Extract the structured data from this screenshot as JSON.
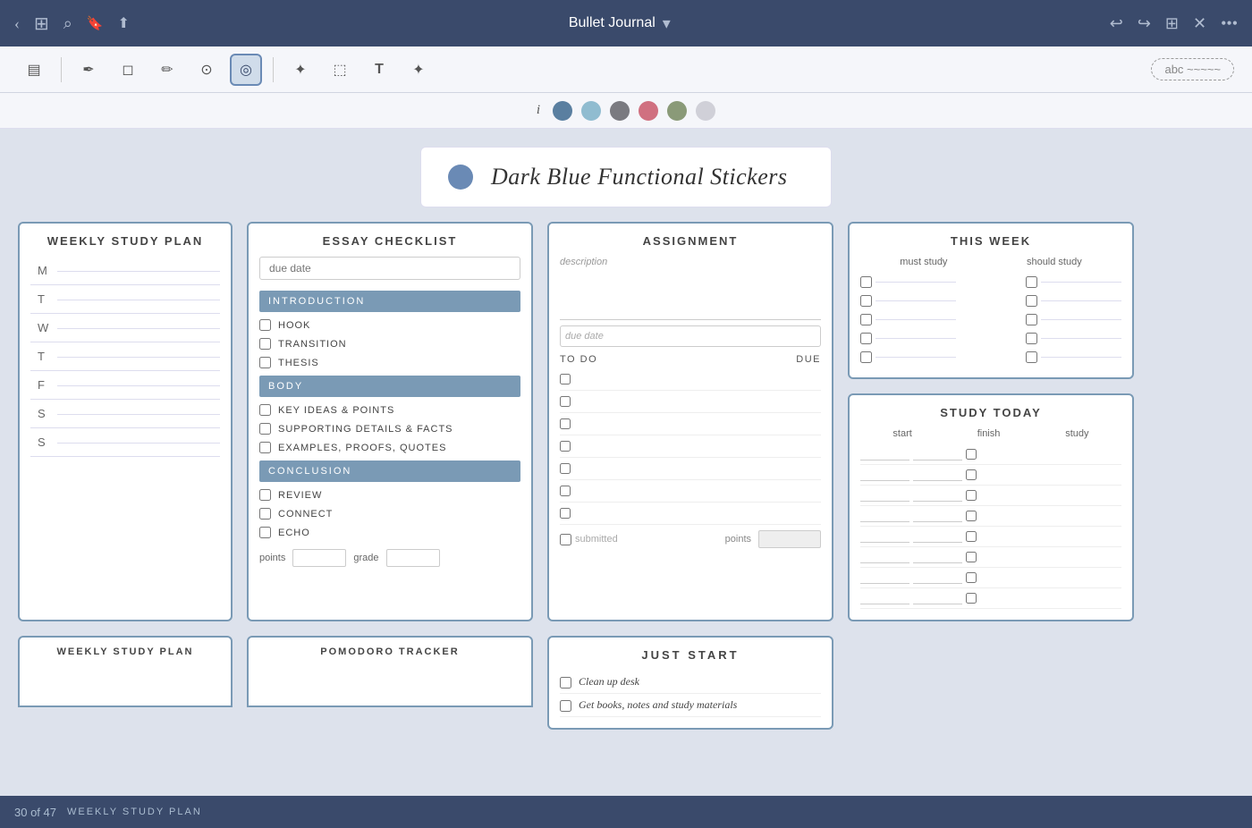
{
  "app": {
    "title": "Bullet Journal",
    "title_arrow": "▾"
  },
  "nav": {
    "back_icon": "‹",
    "forward_icon": "›",
    "add_icon": "+",
    "close_icon": "✕",
    "more_icon": "•••",
    "grid_icon": "⊞",
    "search_icon": "⌕",
    "bookmark_icon": "🔖",
    "share_icon": "⬆"
  },
  "toolbar": {
    "panel_icon": "▤",
    "pen_icon": "/",
    "eraser_icon": "◻",
    "highlighter_icon": "✏",
    "lasso_icon": "⊙",
    "lasso_active": true,
    "shapes_icon": "✦",
    "image_icon": "⬚",
    "text_icon": "T",
    "wand_icon": "✦",
    "abc_label": "abc ~~~~~"
  },
  "palette": {
    "italic_i": "i",
    "colors": [
      {
        "id": "dark-blue",
        "hex": "#5a7fa0"
      },
      {
        "id": "light-blue",
        "hex": "#90bcd0"
      },
      {
        "id": "gray",
        "hex": "#7a7a80"
      },
      {
        "id": "pink",
        "hex": "#d07080"
      },
      {
        "id": "sage",
        "hex": "#8a9a78"
      },
      {
        "id": "light-gray",
        "hex": "#d0d0d8"
      }
    ]
  },
  "title_card": {
    "dot_color": "#6a8ab5",
    "title": "Dark Blue Functional Stickers"
  },
  "weekly_study_plan": {
    "title": "WEEKLY STUDY PLAN",
    "days": [
      "M",
      "T",
      "W",
      "T",
      "F",
      "S",
      "S"
    ]
  },
  "essay_checklist": {
    "title": "ESSAY CHECKLIST",
    "due_placeholder": "due date",
    "sections": [
      {
        "type": "header",
        "label": "INTRODUCTION"
      },
      {
        "type": "check",
        "label": "HOOK"
      },
      {
        "type": "check",
        "label": "TRANSITION"
      },
      {
        "type": "check",
        "label": "THESIS"
      },
      {
        "type": "header",
        "label": "BODY"
      },
      {
        "type": "check",
        "label": "KEY IDEAS & POINTS"
      },
      {
        "type": "check",
        "label": "SUPPORTING DETAILS & FACTS"
      },
      {
        "type": "check",
        "label": "EXAMPLES, PROOFS, QUOTES"
      },
      {
        "type": "header",
        "label": "CONCLUSION"
      },
      {
        "type": "check",
        "label": "REVIEW"
      },
      {
        "type": "check",
        "label": "CONNECT"
      },
      {
        "type": "check",
        "label": "ECHO"
      }
    ],
    "points_label": "points",
    "grade_label": "grade"
  },
  "assignment": {
    "title": "ASSIGNMENT",
    "description_label": "description",
    "due_placeholder": "due date",
    "todo_header": "TO DO",
    "due_header": "due",
    "submitted_label": "submitted",
    "points_label": "points",
    "todo_rows": 7
  },
  "this_week": {
    "title": "THIS WEEK",
    "col1": "must study",
    "col2": "should study",
    "rows": 5
  },
  "study_today": {
    "title": "STUDY TODAY",
    "col1": "start",
    "col2": "finish",
    "col3": "study",
    "rows": 8
  },
  "just_start": {
    "title": "JUST START",
    "items": [
      "Clean up desk",
      "Get books, notes and study materials"
    ]
  },
  "bottom_bar": {
    "page_count": "30 of 47",
    "page_label": "WEEKLY STUDY PLAN"
  },
  "bottom_cards": {
    "left_title": "WEEKLY STUDY PLAN",
    "right_title": "POMODORO TRACKER"
  }
}
